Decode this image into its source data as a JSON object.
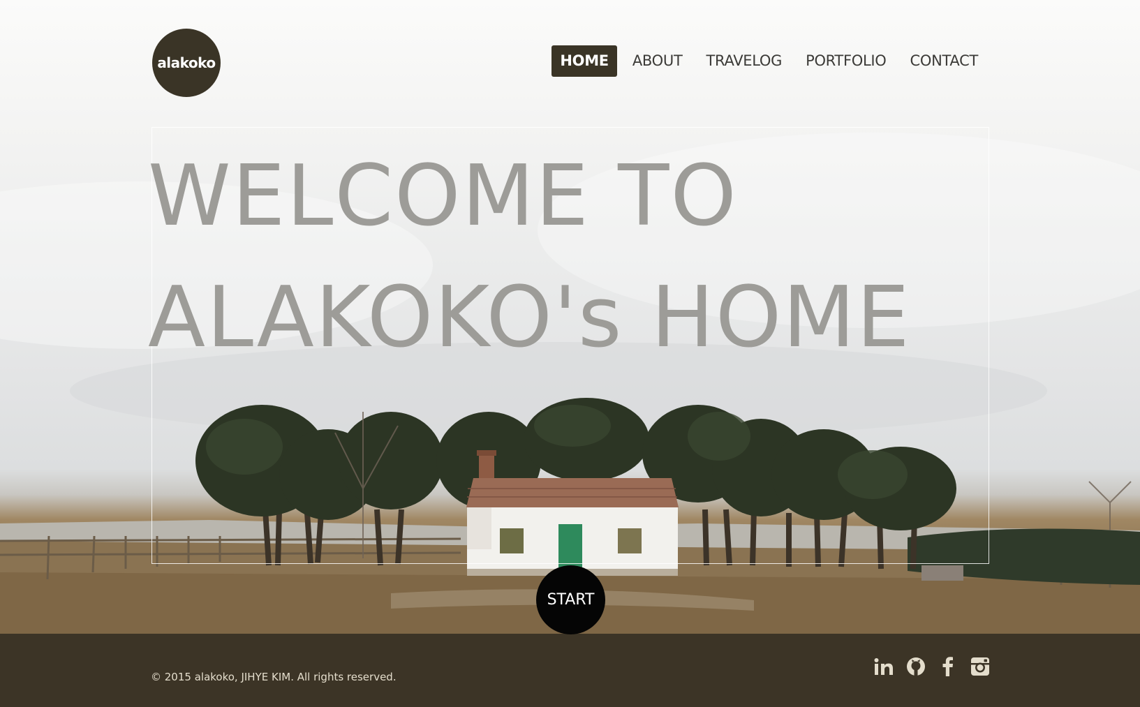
{
  "logo": {
    "text": "alakoko"
  },
  "nav": {
    "items": [
      {
        "label": "HOME",
        "active": true
      },
      {
        "label": "ABOUT"
      },
      {
        "label": "TRAVELOG"
      },
      {
        "label": "PORTFOLIO"
      },
      {
        "label": "CONTACT"
      }
    ]
  },
  "hero": {
    "line1": "WELCOME TO",
    "line2": "ALAKOKO's HOME",
    "start_label": "START"
  },
  "footer": {
    "copyright": "© 2015 alakoko, JIHYE KIM. All rights reserved.",
    "social_icons": [
      "linkedin-icon",
      "github-icon",
      "facebook-icon",
      "instagram-icon"
    ]
  },
  "colors": {
    "brand_dark": "#3a3426",
    "headline": "#9d9c98",
    "footer_bg": "#3c3426",
    "footer_text": "#e4ddcc",
    "start_bg": "#050505"
  }
}
